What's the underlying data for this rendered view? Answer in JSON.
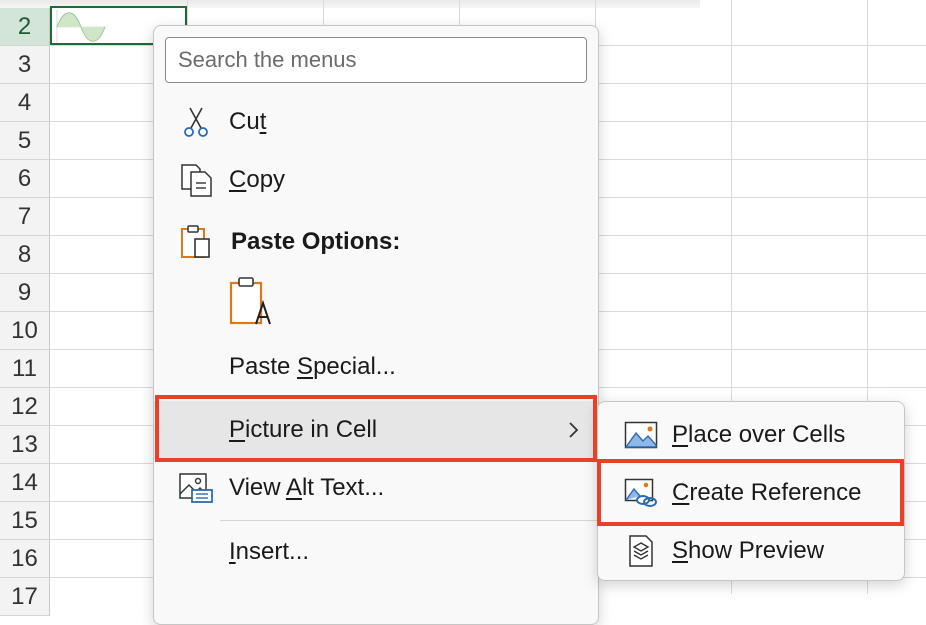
{
  "sheet": {
    "rows": [
      "2",
      "3",
      "4",
      "5",
      "6",
      "7",
      "8",
      "9",
      "10",
      "11",
      "12",
      "13",
      "14",
      "15",
      "16",
      "17"
    ],
    "active_row": "2"
  },
  "context_menu": {
    "search_placeholder": "Search the menus",
    "items": {
      "cut": {
        "pre": "Cu",
        "accel": "t",
        "post": ""
      },
      "copy": {
        "pre": "",
        "accel": "C",
        "post": "opy"
      },
      "paste_options": "Paste Options:",
      "paste_special": {
        "pre": "Paste ",
        "accel": "S",
        "post": "pecial..."
      },
      "picture_in_cell": {
        "pre": "",
        "accel": "P",
        "post": "icture in Cell"
      },
      "view_alt_text": {
        "pre": "View ",
        "accel": "A",
        "post": "lt Text..."
      },
      "insert": {
        "pre": "",
        "accel": "I",
        "post": "nsert..."
      }
    }
  },
  "submenu": {
    "items": {
      "place_over_cells": {
        "pre": "",
        "accel": "P",
        "post": "lace over Cells"
      },
      "create_reference": {
        "pre": "",
        "accel": "C",
        "post": "reate Reference"
      },
      "show_preview": {
        "pre": "",
        "accel": "S",
        "post": "how Preview"
      }
    }
  },
  "colors": {
    "highlight": "#e8402a",
    "selection": "#1e6b3a",
    "icon_blue": "#2b6cb0",
    "icon_orange": "#d97b1c"
  }
}
